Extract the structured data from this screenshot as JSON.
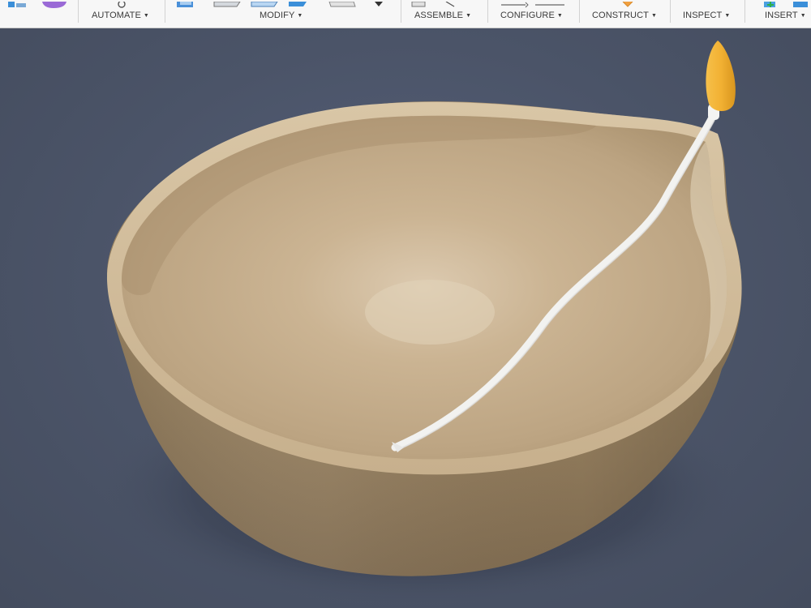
{
  "toolbar": {
    "groups": [
      {
        "label": "AUTOMATE"
      },
      {
        "label": "MODIFY"
      },
      {
        "label": "ASSEMBLE"
      },
      {
        "label": "CONFIGURE"
      },
      {
        "label": "CONSTRUCT"
      },
      {
        "label": "INSPECT"
      },
      {
        "label": "INSERT"
      }
    ],
    "caret": "▼"
  },
  "viewport": {
    "background_color": "#4a5263",
    "model": {
      "bowl_color": "#c4ad88",
      "spout_color": "#f2f2f0",
      "tip_color": "#f2b43a"
    }
  }
}
